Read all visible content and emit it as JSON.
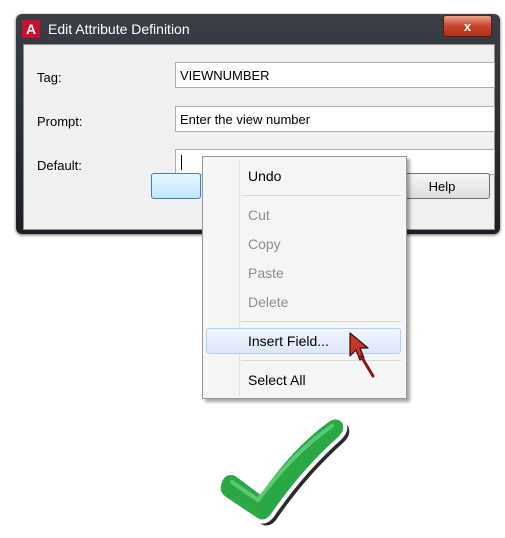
{
  "window": {
    "title": "Edit Attribute Definition",
    "app_icon": {
      "name": "autocad-icon",
      "glyph": "A",
      "color": "#c8102e"
    },
    "close_glyph": "x"
  },
  "form": {
    "tag_label": "Tag:",
    "tag_value": "VIEWNUMBER",
    "prompt_label": "Prompt:",
    "prompt_value": "Enter the view number",
    "default_label": "Default:",
    "default_value": ""
  },
  "buttons": {
    "ok_label": "",
    "help_label": "Help"
  },
  "context_menu": {
    "items": [
      {
        "label": "Undo",
        "enabled": true
      },
      {
        "label": "Cut",
        "enabled": false
      },
      {
        "label": "Copy",
        "enabled": false
      },
      {
        "label": "Paste",
        "enabled": false
      },
      {
        "label": "Delete",
        "enabled": false
      },
      {
        "label": "Insert Field...",
        "enabled": true,
        "highlighted": true
      },
      {
        "label": "Select All",
        "enabled": true
      }
    ]
  },
  "annotations": {
    "cursor_color": "#c0392b",
    "checkmark_color": "#2aa845"
  }
}
